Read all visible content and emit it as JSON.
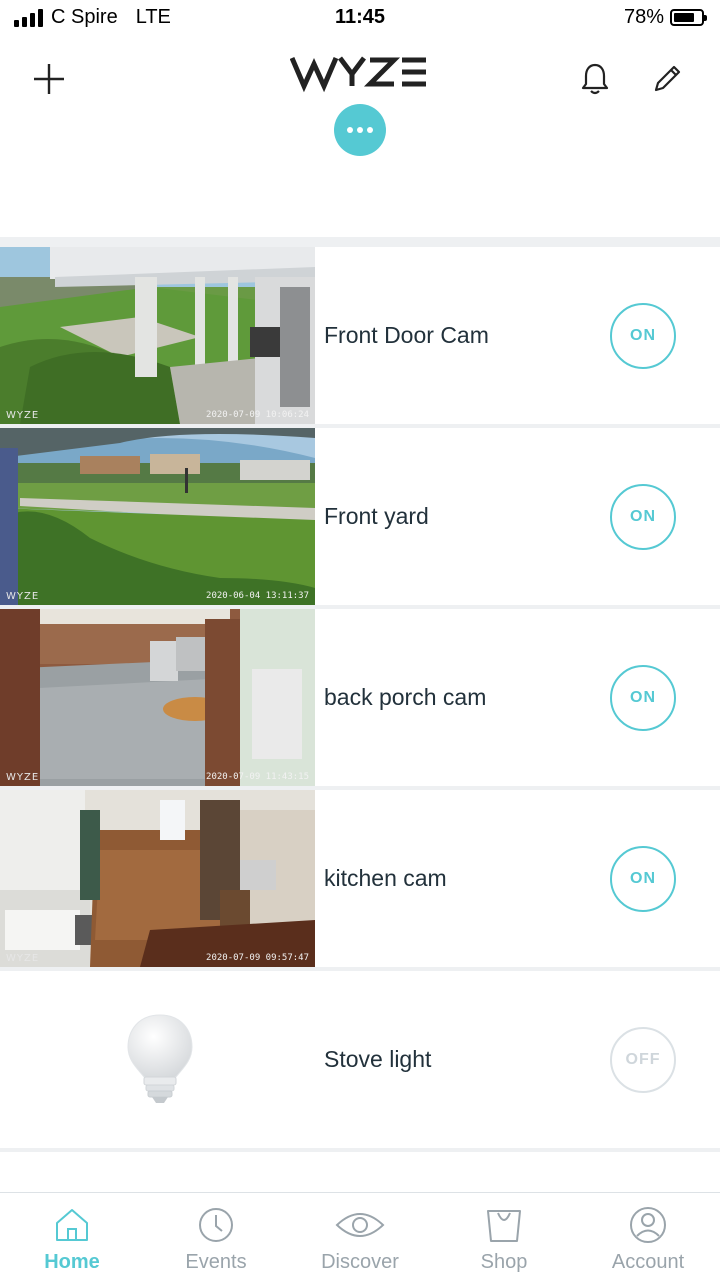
{
  "status_bar": {
    "carrier": "C Spire",
    "network": "LTE",
    "time": "11:45",
    "battery_percent": "78%",
    "battery_level": 0.78
  },
  "header": {
    "logo_text": "WYZE",
    "add_icon": "plus-icon",
    "notifications_icon": "bell-icon",
    "edit_icon": "pencil-icon",
    "more_icon": "ellipsis-icon"
  },
  "colors": {
    "accent": "#55c9d3",
    "text": "#22313b",
    "muted": "#9aa4ab",
    "divider": "#eef0f2",
    "off_border": "#dbe1e5"
  },
  "devices": [
    {
      "name": "Front Door Cam",
      "state": "ON",
      "watermark": "WYZE",
      "timestamp": "2020-07-09 10:06:24"
    },
    {
      "name": "Front yard",
      "state": "ON",
      "watermark": "WYZE",
      "timestamp": "2020-06-04 13:11:37"
    },
    {
      "name": "back porch cam",
      "state": "ON",
      "watermark": "WYZE",
      "timestamp": "2020-07-09 11:43:15"
    },
    {
      "name": "kitchen cam",
      "state": "ON",
      "watermark": "WYZE",
      "timestamp": "2020-07-09 09:57:47"
    },
    {
      "name": "Stove light",
      "state": "OFF",
      "icon": "light-bulb-icon"
    }
  ],
  "bottom_nav": [
    {
      "label": "Home",
      "icon": "home-icon",
      "active": true
    },
    {
      "label": "Events",
      "icon": "clock-icon",
      "active": false
    },
    {
      "label": "Discover",
      "icon": "eye-icon",
      "active": false
    },
    {
      "label": "Shop",
      "icon": "shopping-bag-icon",
      "active": false
    },
    {
      "label": "Account",
      "icon": "account-icon",
      "active": false
    }
  ]
}
